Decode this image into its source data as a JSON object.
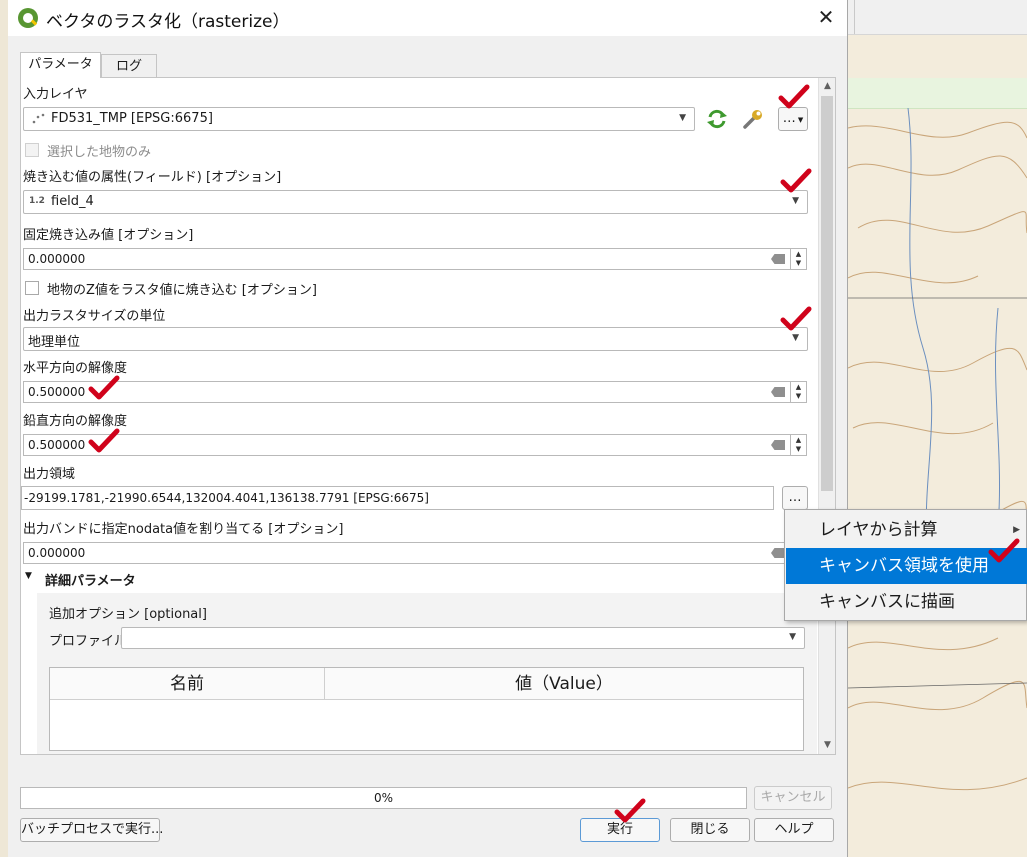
{
  "window": {
    "title": "ベクタのラスタ化（rasterize）",
    "close_glyph": "✕"
  },
  "tabs": [
    {
      "label": "パラメータ"
    },
    {
      "label": "ログ"
    }
  ],
  "input_layer": {
    "label": "入力レイヤ",
    "value": "FD531_TMP [EPSG:6675]",
    "selected_only_label": "選択した地物のみ",
    "more_button": "…"
  },
  "burn_field": {
    "label": "焼き込む値の属性(フィールド) [オプション]",
    "type_badge": "1.2",
    "value": "field_4"
  },
  "fixed_burn": {
    "label": "固定焼き込み値 [オプション]",
    "value": "0.000000"
  },
  "burn_z": {
    "label": "地物のZ値をラスタ値に焼き込む [オプション]"
  },
  "units": {
    "label": "出力ラスタサイズの単位",
    "value": "地理単位"
  },
  "h_res": {
    "label": "水平方向の解像度",
    "value": "0.500000"
  },
  "v_res": {
    "label": "鉛直方向の解像度",
    "value": "0.500000"
  },
  "extent": {
    "label": "出力領域",
    "value": "-29199.1781,-21990.6544,132004.4041,136138.7791 [EPSG:6675]",
    "button": "…"
  },
  "nodata": {
    "label": "出力バンドに指定nodata値を割り当てる [オプション]",
    "value": "0.000000"
  },
  "advanced": {
    "title": "詳細パラメータ",
    "extra_options_label": "追加オプション [optional]",
    "profile_label": "プロファイル",
    "profile_value": "",
    "table_headers": [
      "名前",
      "値（Value）"
    ]
  },
  "progress": {
    "value": 0,
    "text": "0%"
  },
  "buttons": {
    "cancel": "キャンセル",
    "batch": "バッチプロセスで実行...",
    "run": "実行",
    "close": "閉じる",
    "help": "ヘルプ"
  },
  "context_menu": {
    "items": [
      {
        "label": "レイヤから計算"
      },
      {
        "label": "キャンバス領域を使用"
      },
      {
        "label": "キャンバスに描画"
      }
    ]
  },
  "colors": {
    "accent": "#0078d7",
    "checkmark": "#d0021b",
    "qgis_green": "#589632"
  },
  "icons": [
    "qgis-logo-icon",
    "point-layer-icon",
    "iterate-icon",
    "wrench-icon",
    "clear-icon",
    "chevron-down-icon",
    "submenu-arrow-icon",
    "red-check-icon"
  ]
}
